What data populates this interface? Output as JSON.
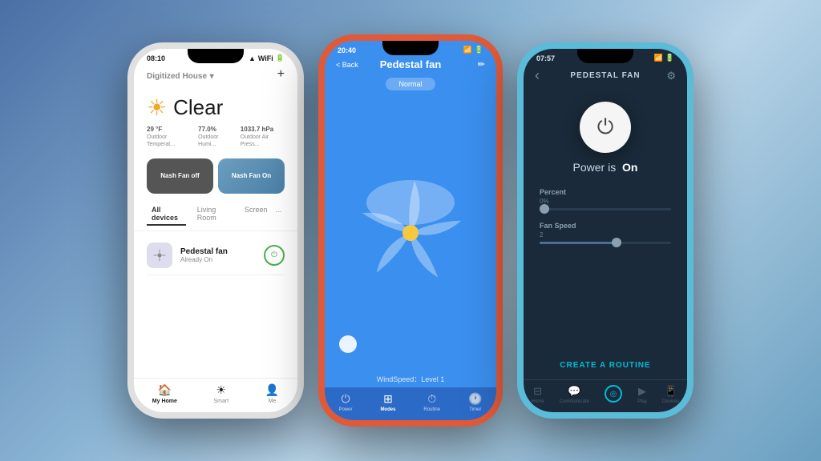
{
  "phone1": {
    "status_time": "08:10",
    "header_title": "Digitized House",
    "header_dropdown": "▾",
    "add_icon": "+",
    "weather_condition": "Clear",
    "weather_icon": "☀",
    "temp": "29 °F",
    "temp_label": "Outdoor Temperat...",
    "humidity": "77.0%",
    "humidity_label": "Outdoor Humi...",
    "pressure": "1033.7 hPa",
    "pressure_label": "Outdoor Air Press...",
    "fan_off_label": "Nash Fan off",
    "fan_on_label": "Nash Fan On",
    "tabs": [
      "All devices",
      "Living Room",
      "Screen"
    ],
    "tab_more": "...",
    "device_name": "Pedestal fan",
    "device_status": "Already On",
    "nav_home": "My Home",
    "nav_smart": "Smart",
    "nav_me": "Me"
  },
  "phone2": {
    "status_time": "20:40",
    "back_label": "< Back",
    "title": "Pedestal fan",
    "edit_icon": "✏",
    "mode_badge": "Normal",
    "wind_speed_label": "WindSpeed：Level 1",
    "nav_power": "Power",
    "nav_modes": "Modes",
    "nav_routine": "Routine",
    "nav_timer": "Timer"
  },
  "phone3": {
    "status_time": "07:57",
    "back_icon": "‹",
    "title": "PEDESTAL FAN",
    "settings_icon": "⚙",
    "power_status": "Power is",
    "power_on": "On",
    "percent_label": "Percent",
    "percent_value": "0%",
    "fan_speed_label": "Fan Speed",
    "fan_speed_value": "2",
    "routine_btn": "CREATE A ROUTINE",
    "nav_home": "Home",
    "nav_communicate": "Communicate",
    "nav_alexa": "",
    "nav_play": "Play",
    "nav_devices": "Devices"
  },
  "colors": {
    "accent_blue": "#3b8fef",
    "accent_teal": "#00bcd4",
    "dark_bg": "#1a2a3a",
    "power_green": "#4caf50"
  }
}
